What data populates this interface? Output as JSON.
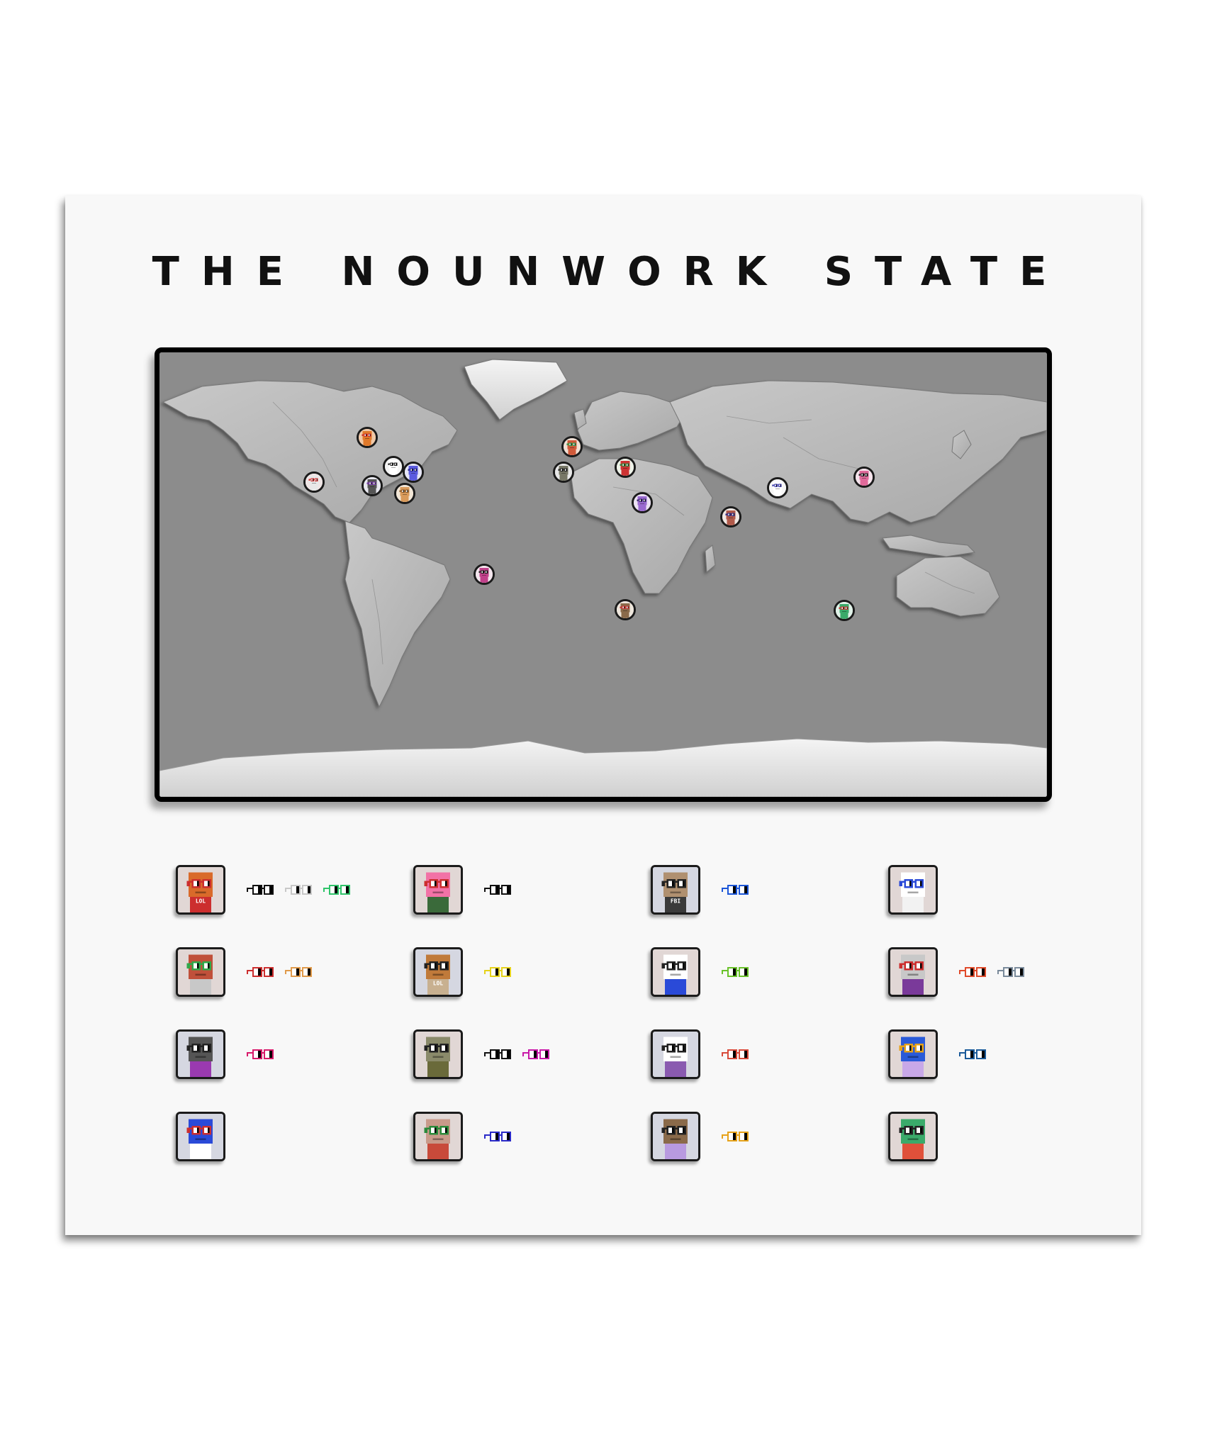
{
  "title": "THE NOUNWORK STATE",
  "map": {
    "style": "grayscale shaded-relief world map",
    "pins": [
      {
        "name": "pin-western-canada",
        "bg": "#f0c9a8",
        "head": "#e0792a",
        "glasses": "#cc2e2e"
      },
      {
        "name": "pin-california",
        "bg": "#f0e6e6",
        "head": "#e8e8e8",
        "glasses": "#d02a2a"
      },
      {
        "name": "pin-rockies-panda",
        "bg": "#f4f4f4",
        "head": "#ffffff",
        "glasses": "#222222"
      },
      {
        "name": "pin-great-lakes",
        "bg": "#e6e6f6",
        "head": "#5a5adf",
        "glasses": "#2a2a8f"
      },
      {
        "name": "pin-texas",
        "bg": "#e8e8f0",
        "head": "#555555",
        "glasses": "#7a3bb0"
      },
      {
        "name": "pin-gulf",
        "bg": "#f2e6d6",
        "head": "#d99a5a",
        "glasses": "#8a5a2a"
      },
      {
        "name": "pin-brazil",
        "bg": "#f4e6ee",
        "head": "#c0408a",
        "glasses": "#222222"
      },
      {
        "name": "pin-uk",
        "bg": "#f2e0d4",
        "head": "#d05a3a",
        "glasses": "#2a9a4a"
      },
      {
        "name": "pin-spain",
        "bg": "#e8e8e8",
        "head": "#777766",
        "glasses": "#222222"
      },
      {
        "name": "pin-balkans",
        "bg": "#eef2e8",
        "head": "#cc3333",
        "glasses": "#2a8a3a"
      },
      {
        "name": "pin-egypt",
        "bg": "#ece2f4",
        "head": "#9a6ad0",
        "glasses": "#3a2a6a"
      },
      {
        "name": "pin-india",
        "bg": "#f0e8e4",
        "head": "#b05a4a",
        "glasses": "#2a2a8a"
      },
      {
        "name": "pin-tibet",
        "bg": "#f6f6f6",
        "head": "#ffffff",
        "glasses": "#3333aa"
      },
      {
        "name": "pin-japan",
        "bg": "#f6e4ec",
        "head": "#e06a9a",
        "glasses": "#222222"
      },
      {
        "name": "pin-south-africa",
        "bg": "#eee6dc",
        "head": "#8a6a4a",
        "glasses": "#cc3333"
      },
      {
        "name": "pin-australia",
        "bg": "#e0f2e8",
        "head": "#3aaa6a",
        "glasses": "#cc3333"
      }
    ]
  },
  "nouns": [
    {
      "name": "noun-lol-fire",
      "bg": "#e1d7d5",
      "head": "#d96a2a",
      "body": "#cc2e2e",
      "body_text": "LOL",
      "glasses": "#cc2e2e",
      "badges": [
        "#111111",
        "#c8c8c8",
        "#2fc46a"
      ]
    },
    {
      "name": "noun-pink-squid",
      "bg": "#e1d7d5",
      "head": "#f272a6",
      "body": "#3a6a3a",
      "body_text": "",
      "glasses": "#cc2e2e",
      "badges": [
        "#111111"
      ]
    },
    {
      "name": "noun-fox-fbi",
      "bg": "#d5d7e1",
      "head": "#b09070",
      "body": "#3a3a3a",
      "body_text": "FBI",
      "glasses": "#222222",
      "badges": [
        "#1c56d8"
      ]
    },
    {
      "name": "noun-duck",
      "bg": "#e1d7d5",
      "head": "#ffffff",
      "body": "#f2f2f2",
      "body_text": "",
      "glasses": "#2a4ad8",
      "badges": []
    },
    {
      "name": "noun-brick",
      "bg": "#e1d7d5",
      "head": "#c0503a",
      "body": "#c8c8c8",
      "body_text": "",
      "glasses": "#2fa84a",
      "badges": [
        "#cc2e2e",
        "#e09a4a"
      ]
    },
    {
      "name": "noun-lol-hat",
      "bg": "#d5d7e1",
      "head": "#c07a3a",
      "body": "#c8b090",
      "body_text": "LOL",
      "glasses": "#222222",
      "badges": [
        "#e6d21a"
      ]
    },
    {
      "name": "noun-chicken",
      "bg": "#e1d7d5",
      "head": "#ffffff",
      "body": "#2a4ad8",
      "body_text": "",
      "glasses": "#222222",
      "badges": [
        "#6ac22a"
      ]
    },
    {
      "name": "noun-robot",
      "bg": "#e1d7d5",
      "head": "#c8c8c8",
      "body": "#7a3a9a",
      "body_text": "",
      "glasses": "#cc2e2e",
      "badges": [
        "#e04a2a",
        "#7a8a9a"
      ]
    },
    {
      "name": "noun-helmet",
      "bg": "#d5d7e1",
      "head": "#555555",
      "body": "#9a3ab0",
      "body_text": "",
      "glasses": "#222222",
      "badges": [
        "#d81a6a"
      ]
    },
    {
      "name": "noun-bunny",
      "bg": "#e1d7d5",
      "head": "#8a8a6a",
      "body": "#6a6a3a",
      "body_text": "",
      "glasses": "#222222",
      "badges": [
        "#111111",
        "#c81aa8"
      ]
    },
    {
      "name": "noun-panda",
      "bg": "#d5d7e1",
      "head": "#ffffff",
      "body": "#8a5ab0",
      "body_text": "",
      "glasses": "#222222",
      "badges": [
        "#d84a3a"
      ]
    },
    {
      "name": "noun-computer",
      "bg": "#e1d7d5",
      "head": "#2a5ad8",
      "body": "#c8a8e8",
      "body_text": "",
      "glasses": "#e6a21a",
      "badges": [
        "#1a5a9a"
      ]
    },
    {
      "name": "noun-wizard",
      "bg": "#d5d7e1",
      "head": "#2a4ad8",
      "body": "#ffffff",
      "body_text": "",
      "glasses": "#cc2e2e",
      "badges": []
    },
    {
      "name": "noun-rabbit",
      "bg": "#e1d7d5",
      "head": "#c89a8a",
      "body": "#c84a3a",
      "body_text": "",
      "glasses": "#2a8a3a",
      "badges": [
        "#2a2ac8"
      ]
    },
    {
      "name": "noun-ship",
      "bg": "#d5d7e1",
      "head": "#8a6a4a",
      "body": "#b89ae0",
      "body_text": "",
      "glasses": "#222222",
      "badges": [
        "#e6a21a"
      ]
    },
    {
      "name": "noun-frog",
      "bg": "#e1d7d5",
      "head": "#3aaa6a",
      "body": "#e0503a",
      "body_text": "",
      "glasses": "#222222",
      "badges": []
    }
  ]
}
